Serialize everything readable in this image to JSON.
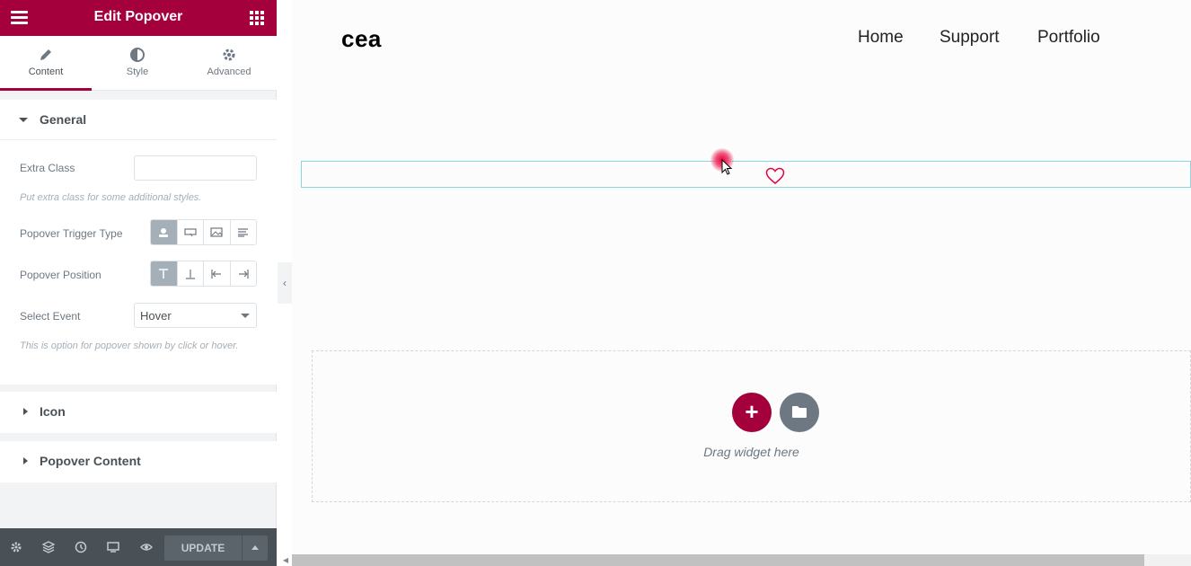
{
  "panel": {
    "title": "Edit Popover",
    "tabs": [
      {
        "label": "Content",
        "icon": "pencil-icon",
        "active": true
      },
      {
        "label": "Style",
        "icon": "half-circle-icon",
        "active": false
      },
      {
        "label": "Advanced",
        "icon": "gear-icon",
        "active": false
      }
    ],
    "general": {
      "title": "General",
      "extra_class_label": "Extra Class",
      "extra_class_value": "",
      "extra_class_hint": "Put extra class for some additional styles.",
      "trigger_type_label": "Popover Trigger Type",
      "trigger_type_options": [
        "user-icon",
        "button-icon",
        "image-icon",
        "text-icon"
      ],
      "trigger_type_selected": 0,
      "position_label": "Popover Position",
      "position_options": [
        "top-icon",
        "bottom-icon",
        "left-icon",
        "right-icon"
      ],
      "position_selected": 0,
      "select_event_label": "Select Event",
      "select_event_value": "Hover",
      "select_event_hint": "This is option for popover shown by click or hover."
    },
    "sections": [
      {
        "title": "Icon"
      },
      {
        "title": "Popover Content"
      }
    ],
    "footer": {
      "update_label": "UPDATE",
      "icons": [
        "settings-icon",
        "layers-icon",
        "history-icon",
        "responsive-icon",
        "preview-icon"
      ]
    }
  },
  "canvas": {
    "logo": "cea",
    "nav": [
      "Home",
      "Support",
      "Portfolio"
    ],
    "drag_text": "Drag widget here"
  },
  "colors": {
    "brand": "#a4003b",
    "footer": "#495157",
    "selected_option": "#a4afb7",
    "widget_outline": "#88d6e0"
  }
}
